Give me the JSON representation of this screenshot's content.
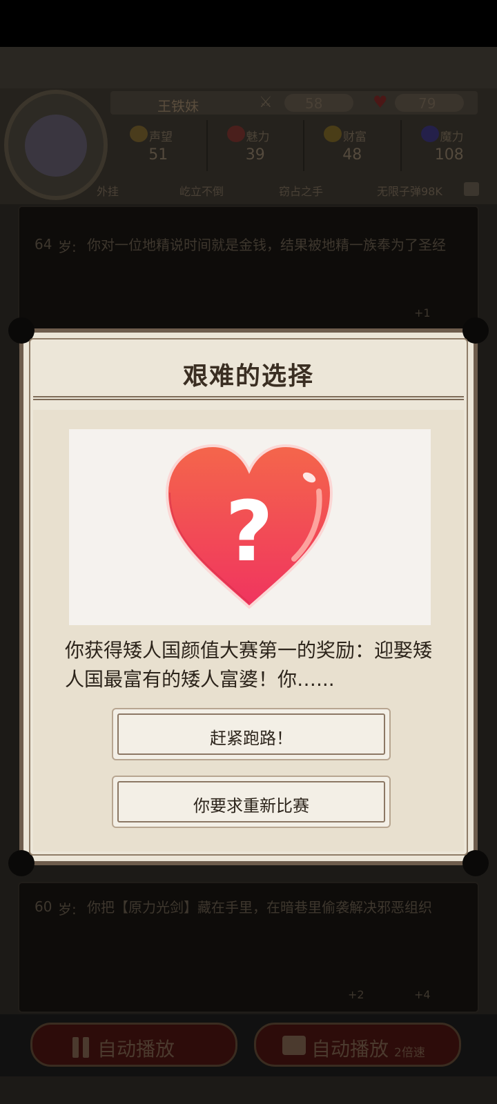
{
  "hud": {
    "player_name": "王铁妹",
    "attack": "58",
    "health": "79",
    "stats": [
      {
        "label": "声望",
        "value": "51",
        "icon": "reputation-icon",
        "color": "#4a3c1c"
      },
      {
        "label": "魅力",
        "value": "39",
        "icon": "charm-icon",
        "color": "#4a1f1c"
      },
      {
        "label": "财富",
        "value": "48",
        "icon": "wealth-icon",
        "color": "#4a3d17"
      },
      {
        "label": "魔力",
        "value": "108",
        "icon": "magic-icon",
        "color": "#24204a"
      }
    ],
    "perks_title": "外挂",
    "perks": [
      "屹立不倒",
      "窃占之手",
      "无限子弹98K"
    ]
  },
  "log": [
    {
      "age": "64",
      "unit": "岁:",
      "text": "你对一位地精说时间就是金钱，结果被地精一族奉为了圣经",
      "rewards": [
        "+1"
      ]
    },
    {
      "age": "60",
      "unit": "岁:",
      "text": "你把【原力光剑】藏在手里，在暗巷里偷袭解决邪恶组织",
      "rewards": [
        "+2",
        "+4"
      ]
    }
  ],
  "controls": {
    "auto_play_label": "自动播放",
    "auto_play_ad_label": "自动播放",
    "speed_label": "2倍速"
  },
  "modal": {
    "title": "艰难的选择",
    "picture_icon": "heart-question-icon",
    "event_text": "你获得矮人国颜值大赛第一的奖励：迎娶矮人国最富有的矮人富婆！你…...",
    "choices": [
      "赶紧跑路！",
      "你要求重新比赛"
    ]
  },
  "colors": {
    "modal_bg": "#ece6d8",
    "modal_border": "#6e5d4d",
    "heart_top": "#f4664b",
    "heart_bottom": "#f0345f"
  }
}
